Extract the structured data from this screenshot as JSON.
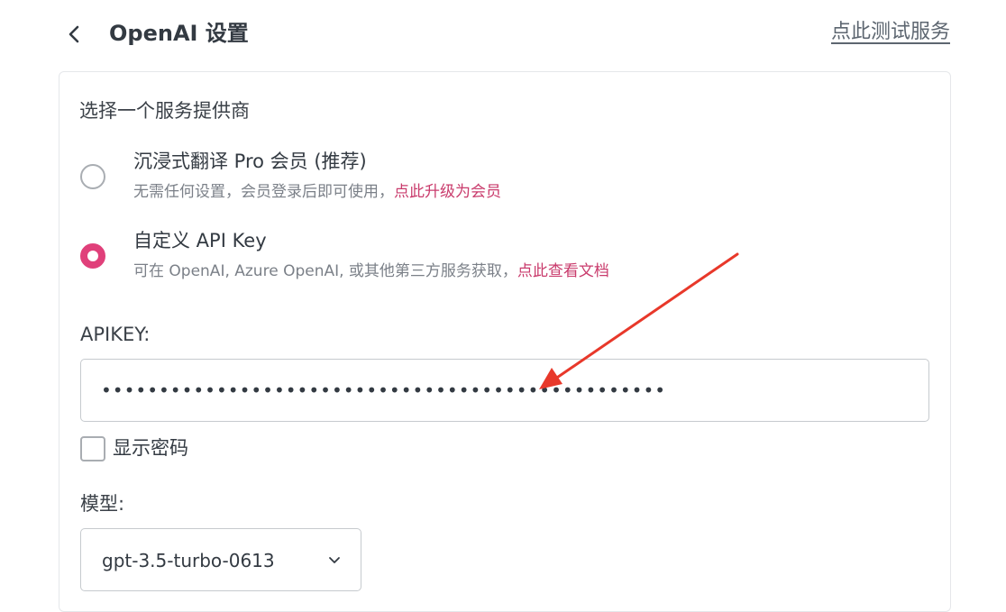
{
  "header": {
    "title": "OpenAI 设置",
    "test_link": "点此测试服务"
  },
  "provider": {
    "label": "选择一个服务提供商",
    "options": [
      {
        "title": "沉浸式翻译 Pro 会员 (推荐)",
        "desc": "无需任何设置，会员登录后即可使用，",
        "link": "点此升级为会员",
        "selected": false
      },
      {
        "title": "自定义 API Key",
        "desc": "可在 OpenAI, Azure OpenAI, 或其他第三方服务获取，",
        "link": "点此查看文档",
        "selected": true
      }
    ]
  },
  "apikey": {
    "label": "APIKEY:",
    "masked_value": "•••••••••••••••••••••••••••••••••••••••••••••••••"
  },
  "show_password": {
    "label": "显示密码",
    "checked": false
  },
  "model": {
    "label": "模型:",
    "selected": "gpt-3.5-turbo-0613"
  },
  "colors": {
    "accent": "#e0407a",
    "link": "#c93b6c",
    "annotation_arrow": "#e8382a"
  },
  "icons": {
    "back": "chevron-left-icon",
    "select": "chevron-down-icon"
  }
}
